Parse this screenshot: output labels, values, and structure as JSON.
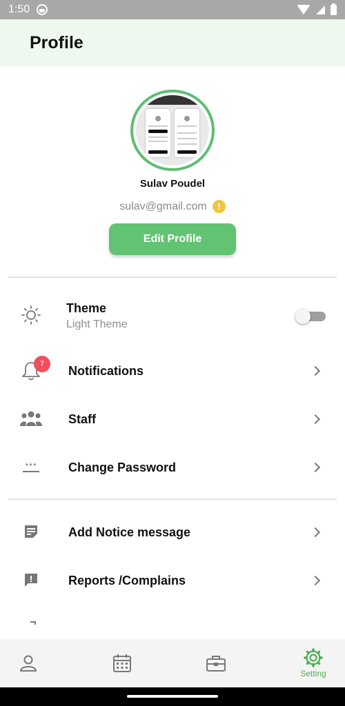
{
  "status_bar": {
    "time": "1:50"
  },
  "header": {
    "title": "Profile"
  },
  "profile": {
    "name": "Sulav Poudel",
    "email": "sulav@gmail.com",
    "warning_glyph": "!",
    "edit_button": "Edit Profile"
  },
  "settings": {
    "theme": {
      "label": "Theme",
      "value": "Light Theme",
      "enabled": false
    },
    "notifications": {
      "label": "Notifications",
      "badge_count": "7"
    },
    "staff": {
      "label": "Staff"
    },
    "change_password": {
      "label": "Change Password",
      "icon_glyph": "***"
    },
    "add_notice": {
      "label": "Add Notice message"
    },
    "reports": {
      "label": "Reports /Complains"
    }
  },
  "bottom_nav": {
    "items": [
      {
        "icon": "person-icon",
        "label": ""
      },
      {
        "icon": "calendar-icon",
        "label": ""
      },
      {
        "icon": "briefcase-icon",
        "label": ""
      },
      {
        "icon": "gear-icon",
        "label": "Setting",
        "active": true
      }
    ]
  },
  "colors": {
    "accent": "#62c373",
    "header_bg": "#eef8ee",
    "badge": "#ef4f5f",
    "warning": "#f3c43e"
  }
}
